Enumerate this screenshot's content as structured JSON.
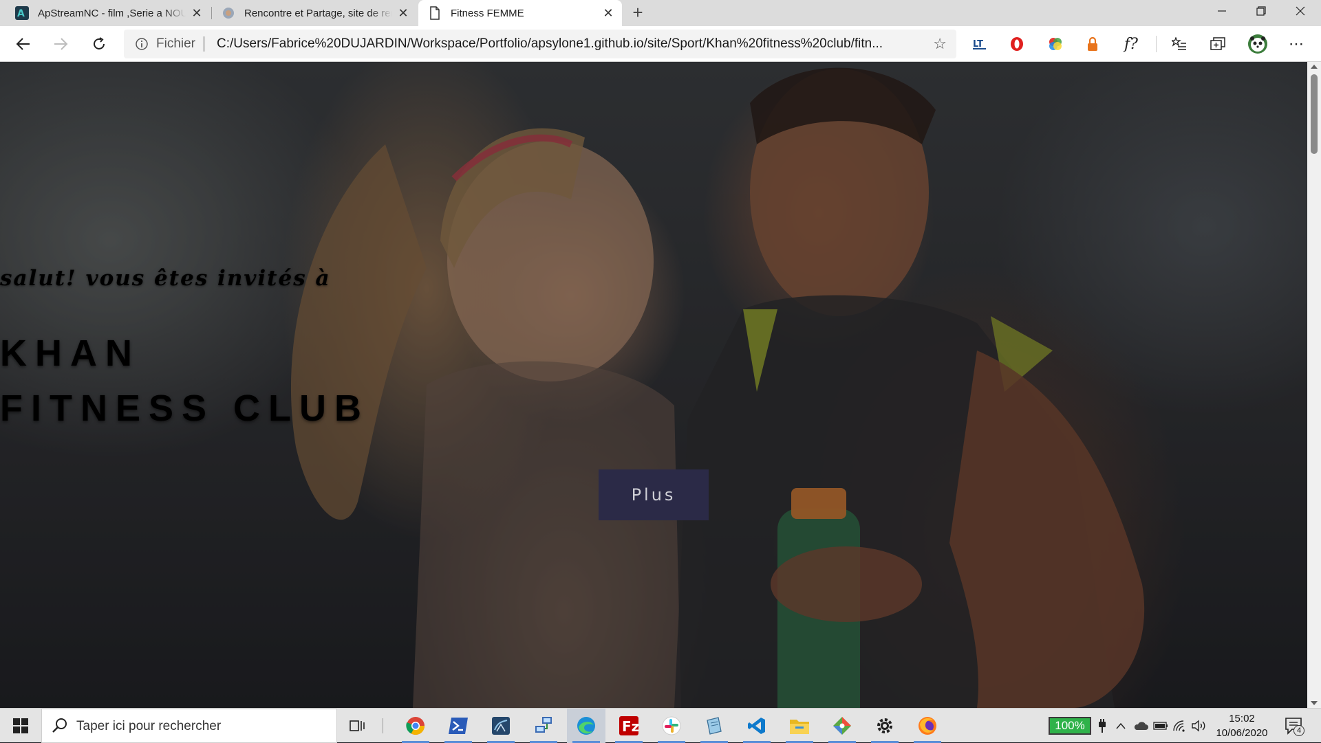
{
  "browser": {
    "tabs": [
      {
        "title": "ApStreamNC - film ,Serie a NOUVEAU",
        "icon": "apstream-favicon"
      },
      {
        "title": "Rencontre et Partage, site de rencontre",
        "icon": "globe-favicon"
      },
      {
        "title": "Fitness FEMME",
        "icon": "page-icon"
      }
    ],
    "address": {
      "scheme_label": "Fichier",
      "url": "C:/Users/Fabrice%20DUJARDIN/Workspace/Portfolio/apsylone1.github.io/site/Sport/Khan%20fitness%20club/fitn..."
    },
    "extensions": [
      "translate-icon",
      "opera-icon",
      "colorful-pinwheel-icon",
      "lock-orange-icon",
      "font-finder-icon"
    ]
  },
  "hero": {
    "invite": "salut! vous êtes invités à",
    "brand_line1": "KHAN",
    "brand_line2": "FITNESS CLUB",
    "button_label": "Plus"
  },
  "taskbar": {
    "search_placeholder": "Taper ici pour rechercher",
    "battery_percent": "100%",
    "time": "15:02",
    "date": "10/06/2020",
    "notifications": "4"
  },
  "colors": {
    "accent_button": "#2b2a47",
    "taskbar_running": "#5a8ed8",
    "battery_green": "#2fb24a"
  }
}
